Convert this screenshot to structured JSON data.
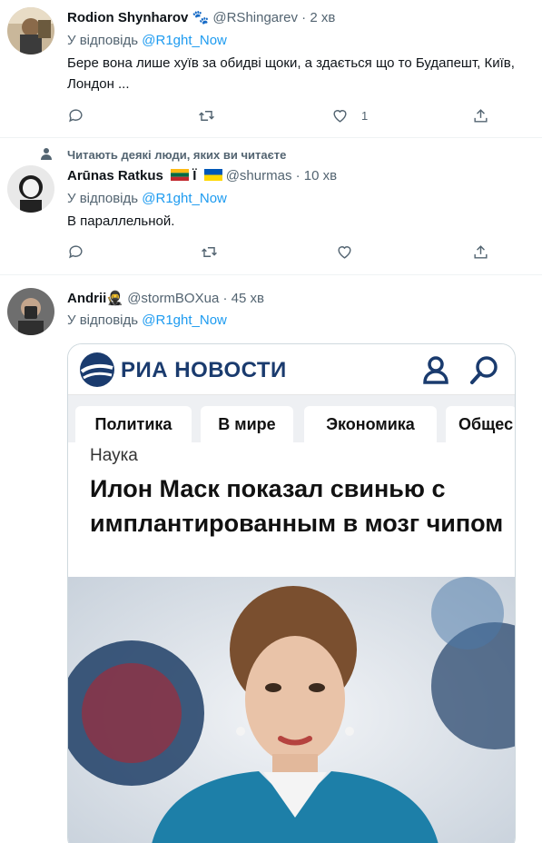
{
  "reply_prefix": "У відповідь",
  "tweets": [
    {
      "name": "Rodion Shynharov",
      "name_suffix": "🐾",
      "handle": "@RShingarev",
      "time": "2 хв",
      "reply_to": "@R1ght_Now",
      "text": "Бере вона лише хуїв  за обидві щоки, а здається що то Будапешт, Київ, Лондон ...",
      "likes": "1"
    },
    {
      "social_context": "Читають деякі люди, яких ви читаєте",
      "name": "Arūnas Ratkus",
      "name_extra": "Ї",
      "handle": "@shurmas",
      "time": "10 хв",
      "reply_to": "@R1ght_Now",
      "text": "В параллельной."
    },
    {
      "name": "Andrii",
      "name_emoji": "🥷",
      "handle": "@stormBOXua",
      "time": "45 хв",
      "reply_to": "@R1ght_Now"
    }
  ],
  "media": {
    "logo": "РИА НОВОСТИ",
    "tabs": [
      "Политика",
      "В мире",
      "Экономика",
      "Общес"
    ],
    "category": "Наука",
    "headline": "Илон Маск показал свинью с имплантированным в мозг чипом"
  },
  "icons": {
    "reply": "reply-icon",
    "retweet": "retweet-icon",
    "like": "heart-icon",
    "share": "share-icon",
    "user": "user-icon",
    "search": "search-icon"
  },
  "colors": {
    "link": "#1d9bf0",
    "muted": "#536471",
    "ria_blue": "#1a3b6e"
  }
}
